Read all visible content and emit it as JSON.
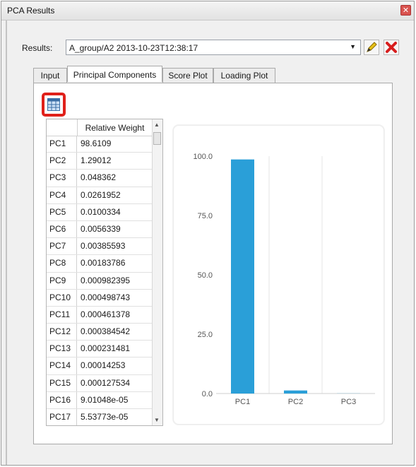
{
  "window": {
    "title": "PCA Results",
    "close_glyph": "✕"
  },
  "results": {
    "label": "Results:",
    "selected": "A_group/A2 2013-10-23T12:38:17",
    "dropdown_arrow": "▼"
  },
  "tabs": [
    {
      "label": "Input",
      "active": false
    },
    {
      "label": "Principal Components",
      "active": true
    },
    {
      "label": "Score Plot",
      "active": false
    },
    {
      "label": "Loading Plot",
      "active": false
    }
  ],
  "table": {
    "column_header": "Relative Weight",
    "rows": [
      {
        "pc": "PC1",
        "value": "98.6109"
      },
      {
        "pc": "PC2",
        "value": "1.29012"
      },
      {
        "pc": "PC3",
        "value": "0.048362"
      },
      {
        "pc": "PC4",
        "value": "0.0261952"
      },
      {
        "pc": "PC5",
        "value": "0.0100334"
      },
      {
        "pc": "PC6",
        "value": "0.0056339"
      },
      {
        "pc": "PC7",
        "value": "0.00385593"
      },
      {
        "pc": "PC8",
        "value": "0.00183786"
      },
      {
        "pc": "PC9",
        "value": "0.000982395"
      },
      {
        "pc": "PC10",
        "value": "0.000498743"
      },
      {
        "pc": "PC11",
        "value": "0.000461378"
      },
      {
        "pc": "PC12",
        "value": "0.000384542"
      },
      {
        "pc": "PC13",
        "value": "0.000231481"
      },
      {
        "pc": "PC14",
        "value": "0.00014253"
      },
      {
        "pc": "PC15",
        "value": "0.000127534"
      },
      {
        "pc": "PC16",
        "value": "9.01048e-05"
      },
      {
        "pc": "PC17",
        "value": "5.53773e-05"
      }
    ]
  },
  "icons": {
    "table_toggle": "table-grid-icon",
    "edit": "pencil-icon",
    "delete": "red-x-icon"
  },
  "colors": {
    "bar": "#2a9fd8",
    "highlight": "#e0201a",
    "delete": "#d81e1e",
    "pencil": "#e8c21a"
  },
  "chart_data": {
    "type": "bar",
    "categories": [
      "PC1",
      "PC2",
      "PC3"
    ],
    "values": [
      98.6109,
      1.29012,
      0.048362
    ],
    "ylim": [
      0,
      100
    ],
    "yticks": [
      "100.0",
      "75.0",
      "50.0",
      "25.0",
      "0.0"
    ],
    "grid": true
  }
}
